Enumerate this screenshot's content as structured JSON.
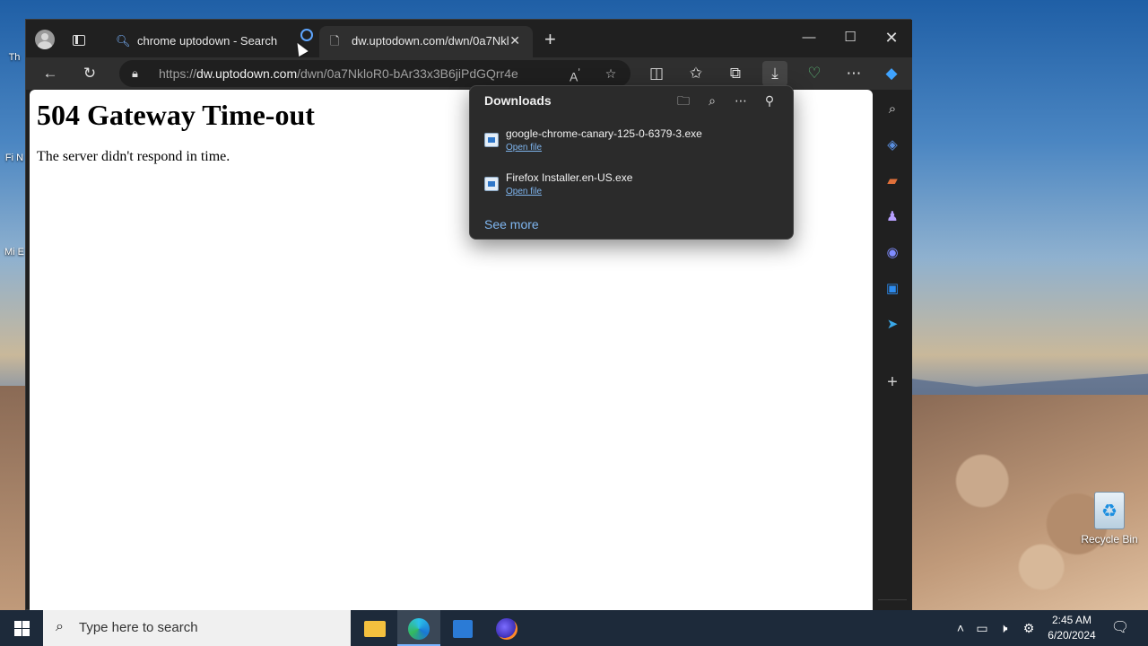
{
  "desktop": {
    "recycle_bin_label": "Recycle Bin",
    "left_icons": [
      "Th",
      "Fi N",
      "Mi E"
    ]
  },
  "browser": {
    "tabs": [
      {
        "label": "chrome uptodown - Search",
        "icon": "search-icon"
      },
      {
        "label": "dw.uptodown.com/dwn/0a7Nklo",
        "icon": "page-icon"
      }
    ],
    "new_tab_symbol": "+",
    "window_controls": {
      "minimize": "—",
      "maximize": "☐",
      "close": "✕"
    },
    "address": {
      "prefix": "https://",
      "host": "dw.uptodown.com",
      "path": "/dwn/0a7NkloR0-bAr33x3B6jiPdGQrr4e0A..."
    }
  },
  "page": {
    "heading": "504 Gateway Time-out",
    "message": "The server didn't respond in time."
  },
  "downloads": {
    "title": "Downloads",
    "items": [
      {
        "name": "google-chrome-canary-125-0-6379-3.exe",
        "action": "Open file"
      },
      {
        "name": "Firefox Installer.en-US.exe",
        "action": "Open file"
      }
    ],
    "see_more": "See more"
  },
  "taskbar": {
    "search_placeholder": "Type here to search",
    "time": "2:45 AM",
    "date": "6/20/2024"
  },
  "colors": {
    "page_bg": "#ffffff",
    "chrome_dark": "#202020",
    "accent_link": "#7fb6f0",
    "taskbar": "#1d2a3a"
  }
}
